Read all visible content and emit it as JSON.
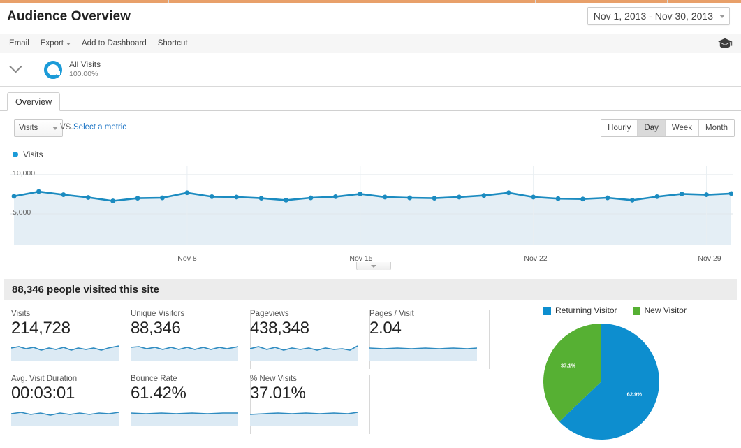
{
  "header": {
    "title": "Audience Overview",
    "date_range": "Nov 1, 2013 - Nov 30, 2013",
    "date_caret_icon": "chevron-down-icon",
    "help_icon": "graduation-cap-icon"
  },
  "toolbar": {
    "email": "Email",
    "export": "Export",
    "export_caret_icon": "chevron-down-icon",
    "add_to_dashboard": "Add to Dashboard",
    "shortcut": "Shortcut"
  },
  "segment_bar": {
    "toggle_icon": "chevron-down-icon",
    "segment_icon": "donut-ring-icon",
    "segment_name": "All Visits",
    "segment_percent": "100.00%"
  },
  "tabs": [
    {
      "label": "Overview",
      "active": true
    }
  ],
  "metric_selector": {
    "selected_metric": "Visits",
    "metric_caret_icon": "chevron-down-icon",
    "vs_label": "VS.",
    "compare_link": "Select a metric"
  },
  "granularity": {
    "options": [
      "Hourly",
      "Day",
      "Week",
      "Month"
    ],
    "selected": "Day"
  },
  "chart_legend": {
    "series_label": "Visits",
    "dot_icon": "legend-dot-icon"
  },
  "summary": {
    "text": "88,346 people visited this site"
  },
  "metrics": [
    {
      "label": "Visits",
      "value": "214,728"
    },
    {
      "label": "Unique Visitors",
      "value": "88,346"
    },
    {
      "label": "Pageviews",
      "value": "438,348"
    },
    {
      "label": "Pages / Visit",
      "value": "2.04"
    },
    {
      "label": "Avg. Visit Duration",
      "value": "00:03:01"
    },
    {
      "label": "Bounce Rate",
      "value": "61.42%"
    },
    {
      "label": "% New Visits",
      "value": "37.01%"
    }
  ],
  "colors": {
    "accent_blue": "#1b9bd8",
    "pie_blue": "#0d8ecf",
    "pie_green": "#56b033",
    "top_rule_orange": "#e8a06a",
    "link_blue": "#1a73c4"
  },
  "drawer": {
    "toggle_icon": "chevron-down-icon"
  },
  "chart_data": [
    {
      "type": "line",
      "title": "Visits",
      "xlabel": "",
      "ylabel": "Visits",
      "ylim": [
        0,
        10000
      ],
      "grid": true,
      "legend_position": "top-left",
      "yticks": [
        "5,000",
        "10,000"
      ],
      "ytick_values": [
        5000,
        10000
      ],
      "xticks": [
        "Nov 8",
        "Nov 15",
        "Nov 22",
        "Nov 29"
      ],
      "xtick_indices": [
        7,
        14,
        21,
        28
      ],
      "x": [
        "Nov 1",
        "Nov 2",
        "Nov 3",
        "Nov 4",
        "Nov 5",
        "Nov 6",
        "Nov 7",
        "Nov 8",
        "Nov 9",
        "Nov 10",
        "Nov 11",
        "Nov 12",
        "Nov 13",
        "Nov 14",
        "Nov 15",
        "Nov 16",
        "Nov 17",
        "Nov 18",
        "Nov 19",
        "Nov 20",
        "Nov 21",
        "Nov 22",
        "Nov 23",
        "Nov 24",
        "Nov 25",
        "Nov 26",
        "Nov 27",
        "Nov 28",
        "Nov 29",
        "Nov 30"
      ],
      "series": [
        {
          "name": "Visits",
          "color": "#1b8bc0",
          "values": [
            7250,
            7850,
            7450,
            7100,
            6650,
            7000,
            7050,
            7700,
            7200,
            7150,
            7000,
            6750,
            7050,
            7200,
            7550,
            7150,
            7050,
            7000,
            7150,
            7350,
            7700,
            7150,
            6950,
            6900,
            7050,
            6750,
            7200,
            7550,
            7450,
            7600
          ]
        }
      ]
    },
    {
      "type": "pie",
      "title": "Visitor Type",
      "legend_position": "top",
      "labels": [
        "Returning Visitor",
        "New Visitor"
      ],
      "values": [
        62.9,
        37.1
      ],
      "value_labels": [
        "62.9%",
        "37.1%"
      ],
      "colors": [
        "#0d8ecf",
        "#56b033"
      ]
    }
  ]
}
